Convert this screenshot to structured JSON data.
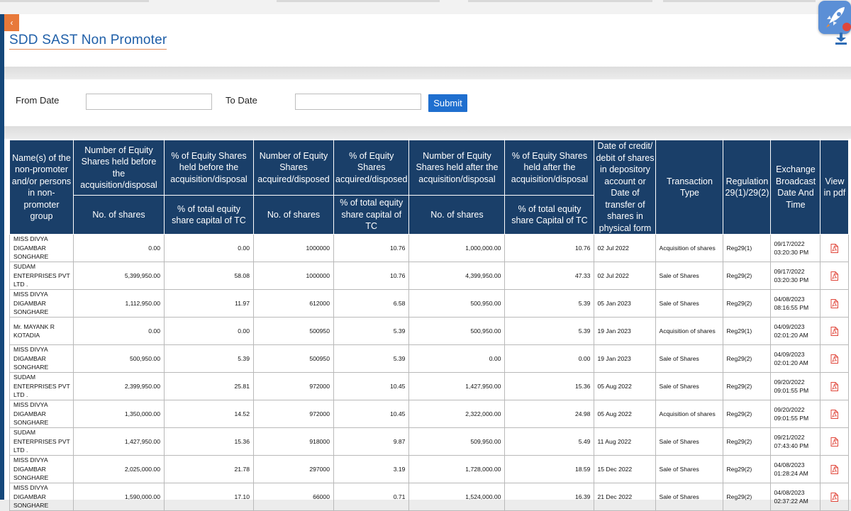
{
  "page": {
    "title": "SDD SAST Non Promoter",
    "collapse_glyph": "‹"
  },
  "filters": {
    "from_label": "From Date",
    "from_value": "",
    "to_label": "To Date",
    "to_value": "",
    "submit_label": "Submit"
  },
  "icons": {
    "rocket": "rocket-icon",
    "download": "download-icon",
    "pdf": "pdf-icon"
  },
  "colors": {
    "header_bg": "#1a3f69",
    "accent_orange": "#e8793a",
    "submit_bg": "#1f6fcf",
    "pdf_red": "#e0463a"
  },
  "table": {
    "headers": {
      "name": "Name(s) of the non-promoter and/or persons in non-promoter group",
      "shares_before": "Number of Equity Shares held before the acquisition/disposal",
      "pct_before": "% of Equity Shares held before the acquisition/disposal",
      "shares_acquired": "Number of Equity Shares acquired/disposed",
      "pct_acquired": "% of Equity Shares acquired/disposed",
      "shares_after": "Number of Equity Shares held after the acquisition/disposal",
      "pct_after": "% of Equity Shares held after the acquisition/disposal",
      "date": "Date of credit/ debit of shares in depository account or Date of transfer of shares in physical form",
      "txn_type": "Transaction Type",
      "regulation": "Regulation 29(1)/29(2)",
      "exchange_date": "Exchange Broadcast Date And Time",
      "view_pdf": "View in pdf",
      "sub_no_shares": "No. of shares",
      "sub_pct_tc_before": "% of total equity share capital of TC",
      "sub_pct_tc_acquired": "% of total equity share capital of TC",
      "sub_pct_tc_after": "% of total equity share Capital of TC"
    },
    "rows": [
      {
        "name": "MISS DIVYA DIGAMBAR SONGHARE",
        "before": "0.00",
        "pct_before": "0.00",
        "acquired": "1000000",
        "pct_acquired": "10.76",
        "after": "1,000,000.00",
        "pct_after": "10.76",
        "date": "02 Jul 2022",
        "type": "Acquisition of shares",
        "reg": "Reg29(1)",
        "exch_date": "09/17/2022",
        "exch_time": "03:20:30 PM"
      },
      {
        "name": "SUDAM ENTERPRISES PVT LTD .",
        "before": "5,399,950.00",
        "pct_before": "58.08",
        "acquired": "1000000",
        "pct_acquired": "10.76",
        "after": "4,399,950.00",
        "pct_after": "47.33",
        "date": "02 Jul 2022",
        "type": "Sale of Shares",
        "reg": "Reg29(2)",
        "exch_date": "09/17/2022",
        "exch_time": "03:20:30 PM"
      },
      {
        "name": "MISS DIVYA DIGAMBAR SONGHARE",
        "before": "1,112,950.00",
        "pct_before": "11.97",
        "acquired": "612000",
        "pct_acquired": "6.58",
        "after": "500,950.00",
        "pct_after": "5.39",
        "date": "05 Jan 2023",
        "type": "Sale of Shares",
        "reg": "Reg29(2)",
        "exch_date": "04/08/2023",
        "exch_time": "08:16:55 PM"
      },
      {
        "name": "Mr. MAYANK R KOTADIA",
        "before": "0.00",
        "pct_before": "0.00",
        "acquired": "500950",
        "pct_acquired": "5.39",
        "after": "500,950.00",
        "pct_after": "5.39",
        "date": "19 Jan 2023",
        "type": "Acquisition of shares",
        "reg": "Reg29(1)",
        "exch_date": "04/09/2023",
        "exch_time": "02:01:20 AM"
      },
      {
        "name": "MISS DIVYA DIGAMBAR SONGHARE",
        "before": "500,950.00",
        "pct_before": "5.39",
        "acquired": "500950",
        "pct_acquired": "5.39",
        "after": "0.00",
        "pct_after": "0.00",
        "date": "19 Jan 2023",
        "type": "Sale of Shares",
        "reg": "Reg29(2)",
        "exch_date": "04/09/2023",
        "exch_time": "02:01:20 AM"
      },
      {
        "name": "SUDAM ENTERPRISES PVT LTD .",
        "before": "2,399,950.00",
        "pct_before": "25.81",
        "acquired": "972000",
        "pct_acquired": "10.45",
        "after": "1,427,950.00",
        "pct_after": "15.36",
        "date": "05 Aug 2022",
        "type": "Sale of Shares",
        "reg": "Reg29(2)",
        "exch_date": "09/20/2022",
        "exch_time": "09:01:55 PM"
      },
      {
        "name": "MISS DIVYA DIGAMBAR SONGHARE",
        "before": "1,350,000.00",
        "pct_before": "14.52",
        "acquired": "972000",
        "pct_acquired": "10.45",
        "after": "2,322,000.00",
        "pct_after": "24.98",
        "date": "05 Aug 2022",
        "type": "Acquisition of shares",
        "reg": "Reg29(2)",
        "exch_date": "09/20/2022",
        "exch_time": "09:01:55 PM"
      },
      {
        "name": "SUDAM ENTERPRISES PVT LTD .",
        "before": "1,427,950.00",
        "pct_before": "15.36",
        "acquired": "918000",
        "pct_acquired": "9.87",
        "after": "509,950.00",
        "pct_after": "5.49",
        "date": "11 Aug 2022",
        "type": "Sale of Shares",
        "reg": "Reg29(2)",
        "exch_date": "09/21/2022",
        "exch_time": "07:43:40 PM"
      },
      {
        "name": "MISS DIVYA DIGAMBAR SONGHARE",
        "before": "2,025,000.00",
        "pct_before": "21.78",
        "acquired": "297000",
        "pct_acquired": "3.19",
        "after": "1,728,000.00",
        "pct_after": "18.59",
        "date": "15 Dec 2022",
        "type": "Sale of Shares",
        "reg": "Reg29(2)",
        "exch_date": "04/08/2023",
        "exch_time": "01:28:24 AM"
      },
      {
        "name": "MISS DIVYA DIGAMBAR SONGHARE",
        "before": "1,590,000.00",
        "pct_before": "17.10",
        "acquired": "66000",
        "pct_acquired": "0.71",
        "after": "1,524,000.00",
        "pct_after": "16.39",
        "date": "21 Dec 2022",
        "type": "Sale of Shares",
        "reg": "Reg29(2)",
        "exch_date": "04/08/2023",
        "exch_time": "02:37:22 AM"
      }
    ]
  }
}
